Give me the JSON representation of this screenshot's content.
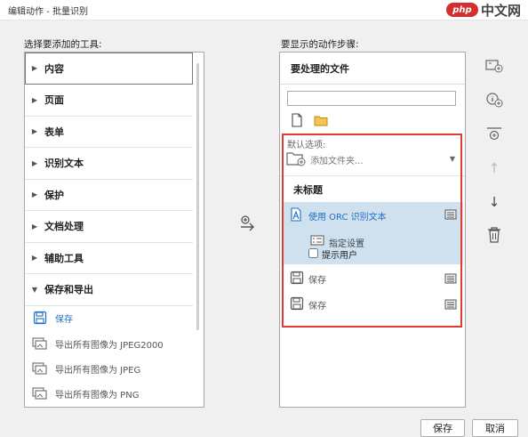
{
  "window": {
    "title": "编辑动作 - 批量识别"
  },
  "watermark": {
    "logo": "php",
    "text": "中文网"
  },
  "left": {
    "caption": "选择要添加的工具:",
    "categories": [
      {
        "label": "内容",
        "expanded": false
      },
      {
        "label": "页面",
        "expanded": false
      },
      {
        "label": "表单",
        "expanded": false
      },
      {
        "label": "识别文本",
        "expanded": false
      },
      {
        "label": "保护",
        "expanded": false
      },
      {
        "label": "文档处理",
        "expanded": false
      },
      {
        "label": "辅助工具",
        "expanded": false
      },
      {
        "label": "保存和导出",
        "expanded": true
      }
    ],
    "save_item": "保存",
    "export_items": [
      "导出所有图像为 JPEG2000",
      "导出所有图像为 JPEG",
      "导出所有图像为 PNG"
    ]
  },
  "right": {
    "caption": "要显示的动作步骤:",
    "files_heading": "要处理的文件",
    "file_input_value": "",
    "default_options_label": "默认选项:",
    "add_folder_label": "添加文件夹...",
    "untitled_label": "未标题",
    "steps": [
      {
        "label": "使用 ORC 识别文本",
        "selected": true
      },
      {
        "label": "保存",
        "selected": false
      },
      {
        "label": "保存",
        "selected": false
      }
    ],
    "specify_settings": "指定设置",
    "prompt_user": "提示用户",
    "prompt_user_checked": false
  },
  "buttons": {
    "save": "保存",
    "cancel": "取消"
  },
  "colors": {
    "accent": "#1f6fc5",
    "highlight": "#cfe0ee",
    "redbox": "#e53935"
  }
}
